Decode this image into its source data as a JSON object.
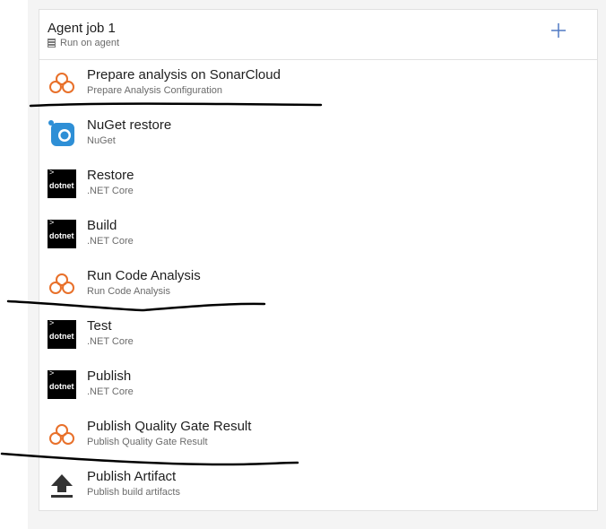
{
  "job": {
    "title": "Agent job 1",
    "subtitle": "Run on agent"
  },
  "tasks": [
    {
      "name": "Prepare analysis on SonarCloud",
      "subtitle": "Prepare Analysis Configuration",
      "icon": "sonarcloud-icon"
    },
    {
      "name": "NuGet restore",
      "subtitle": "NuGet",
      "icon": "nuget-icon"
    },
    {
      "name": "Restore",
      "subtitle": ".NET Core",
      "icon": "dotnet-icon"
    },
    {
      "name": "Build",
      "subtitle": ".NET Core",
      "icon": "dotnet-icon"
    },
    {
      "name": "Run Code Analysis",
      "subtitle": "Run Code Analysis",
      "icon": "sonarcloud-icon"
    },
    {
      "name": "Test",
      "subtitle": ".NET Core",
      "icon": "dotnet-icon"
    },
    {
      "name": "Publish",
      "subtitle": ".NET Core",
      "icon": "dotnet-icon"
    },
    {
      "name": "Publish Quality Gate Result",
      "subtitle": "Publish Quality Gate Result",
      "icon": "sonarcloud-icon"
    },
    {
      "name": "Publish Artifact",
      "subtitle": "Publish build artifacts",
      "icon": "upload-icon"
    }
  ],
  "dotnet_label": "dotnet",
  "dotnet_prompt": ">",
  "colors": {
    "sonar_orange": "#e8702a",
    "nuget_blue": "#2e8fd6",
    "accent_plus": "#4f79c2"
  }
}
